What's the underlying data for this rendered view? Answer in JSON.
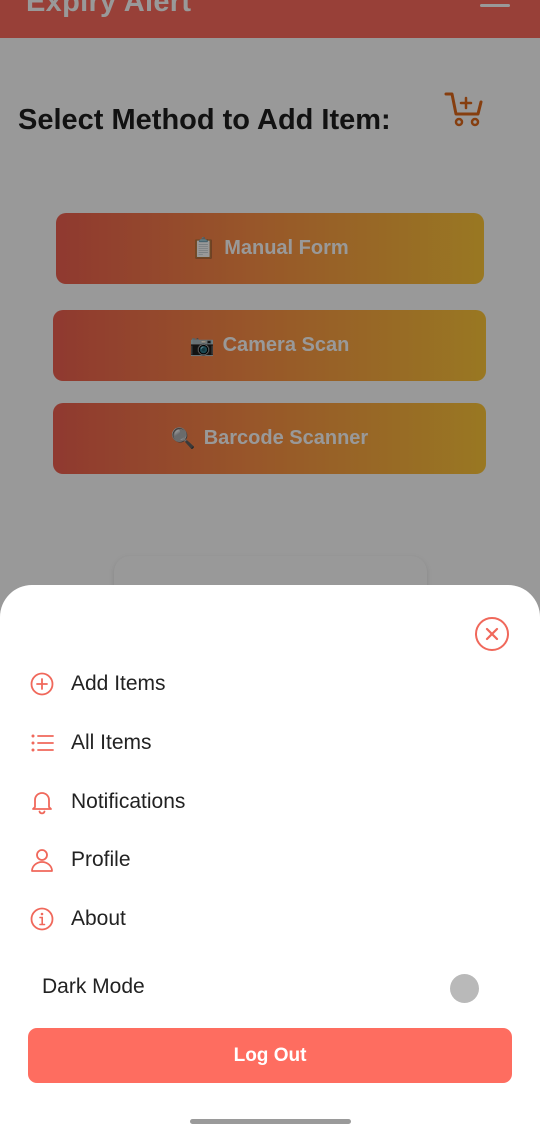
{
  "app": {
    "title": "Expiry Alert"
  },
  "main": {
    "heading": "Select Method to Add Item:",
    "methods": [
      {
        "emoji": "📋",
        "label": "Manual Form"
      },
      {
        "emoji": "📷",
        "label": "Camera Scan"
      },
      {
        "emoji": "🔍",
        "label": "Barcode Scanner"
      }
    ]
  },
  "menu": {
    "items": [
      {
        "label": "Add Items",
        "icon": "plus-circle-icon"
      },
      {
        "label": "All Items",
        "icon": "list-icon"
      },
      {
        "label": "Notifications",
        "icon": "bell-icon"
      },
      {
        "label": "Profile",
        "icon": "user-icon"
      },
      {
        "label": "About",
        "icon": "info-circle-icon"
      }
    ],
    "dark_mode_label": "Dark Mode",
    "dark_mode_on": false,
    "logout_label": "Log Out"
  },
  "colors": {
    "accent": "#fd6c5e",
    "gradient_start": "#f06050",
    "gradient_end": "#ffc83a",
    "toggle_off": "#b9b9b9"
  }
}
